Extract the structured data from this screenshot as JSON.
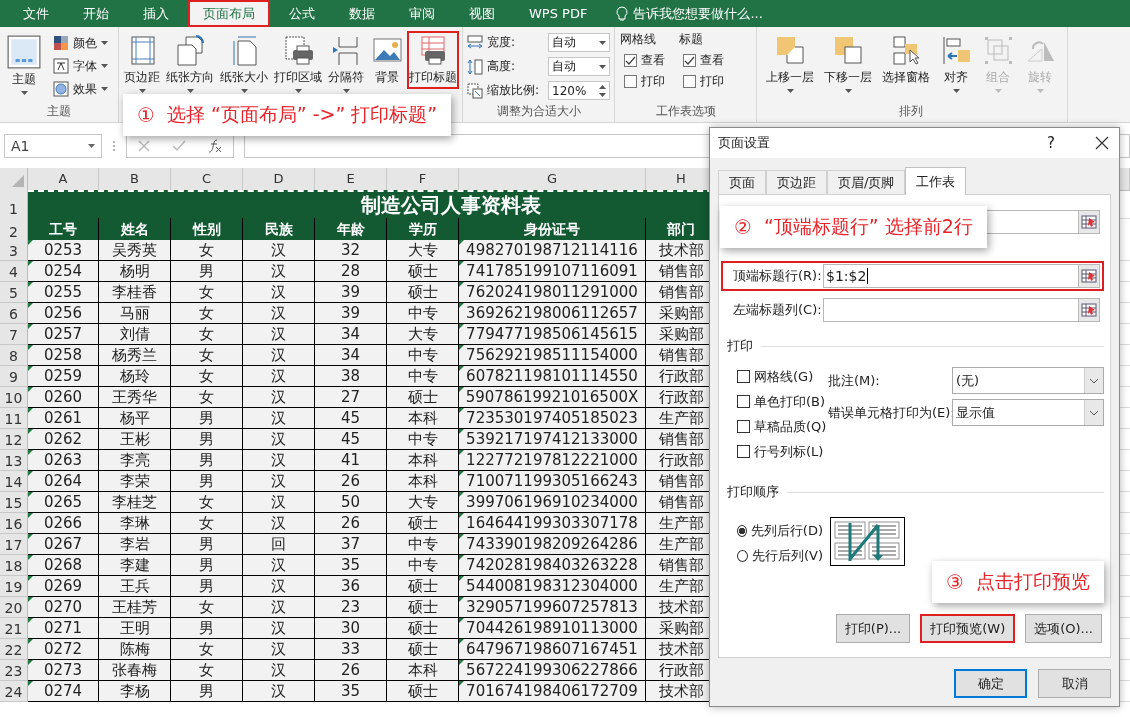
{
  "menu_tabs": [
    {
      "label": "文件",
      "selected": false,
      "highlighted": false
    },
    {
      "label": "开始",
      "selected": false,
      "highlighted": false
    },
    {
      "label": "插入",
      "selected": false,
      "highlighted": false
    },
    {
      "label": "页面布局",
      "selected": true,
      "highlighted": true
    },
    {
      "label": "公式",
      "selected": false,
      "highlighted": false
    },
    {
      "label": "数据",
      "selected": false,
      "highlighted": false
    },
    {
      "label": "审阅",
      "selected": false,
      "highlighted": false
    },
    {
      "label": "视图",
      "selected": false,
      "highlighted": false
    },
    {
      "label": "WPS PDF",
      "selected": false,
      "highlighted": false
    }
  ],
  "tell_me": "告诉我您想要做什么...",
  "ribbon": {
    "theme_group": {
      "label": "主题",
      "button": {
        "label": "主题",
        "has_menu": true
      },
      "options": [
        {
          "label": "颜色",
          "has_menu": true
        },
        {
          "label": "字体",
          "has_menu": true
        },
        {
          "label": "效果",
          "has_menu": true
        }
      ]
    },
    "page_setup_group": {
      "buttons": [
        {
          "label": "页边距",
          "has_menu": true,
          "highlighted": false
        },
        {
          "label": "纸张方向",
          "has_menu": true,
          "highlighted": false
        },
        {
          "label": "纸张大小",
          "has_menu": true,
          "highlighted": false
        },
        {
          "label": "打印区域",
          "has_menu": true,
          "highlighted": false
        },
        {
          "label": "分隔符",
          "has_menu": true,
          "highlighted": false
        },
        {
          "label": "背景",
          "has_menu": false,
          "highlighted": false
        },
        {
          "label": "打印标题",
          "has_menu": false,
          "highlighted": true
        }
      ]
    },
    "scale_group": {
      "label": "调整为合适大小",
      "fields": [
        {
          "label": "宽度:",
          "value": "自动",
          "kind": "dropdown"
        },
        {
          "label": "高度:",
          "value": "自动",
          "kind": "dropdown"
        },
        {
          "label": "缩放比例:",
          "value": "120%",
          "kind": "spinner"
        }
      ]
    },
    "sheet_options_group": {
      "label": "工作表选项",
      "columns": [
        {
          "heading": "网格线",
          "options": [
            {
              "label": "查看",
              "checked": true
            },
            {
              "label": "打印",
              "checked": false
            }
          ]
        },
        {
          "heading": "标题",
          "options": [
            {
              "label": "查看",
              "checked": true
            },
            {
              "label": "打印",
              "checked": false
            }
          ]
        }
      ]
    },
    "arrange_group": {
      "label": "排列",
      "buttons": [
        {
          "label": "上移一层",
          "has_menu": true,
          "disabled": false
        },
        {
          "label": "下移一层",
          "has_menu": true,
          "disabled": false
        },
        {
          "label": "选择窗格",
          "has_menu": false,
          "disabled": false
        },
        {
          "label": "对齐",
          "has_menu": true,
          "disabled": false
        },
        {
          "label": "组合",
          "has_menu": true,
          "disabled": true
        },
        {
          "label": "旋转",
          "has_menu": true,
          "disabled": true
        }
      ]
    }
  },
  "formula_bar": {
    "name_box": "A1"
  },
  "sheet": {
    "columns": [
      "A",
      "B",
      "C",
      "D",
      "E",
      "F",
      "G",
      "H"
    ],
    "title_row": {
      "number": "1",
      "text": "制造公司人事资料表"
    },
    "header_row": {
      "number": "2",
      "cells": [
        "工号",
        "姓名",
        "性别",
        "民族",
        "年龄",
        "学历",
        "身份证号",
        "部门"
      ]
    },
    "rows": [
      {
        "number": "3",
        "cells": [
          "0253",
          "吴秀英",
          "女",
          "汉",
          "32",
          "大专",
          "498270198712114116",
          "技术部"
        ]
      },
      {
        "number": "4",
        "cells": [
          "0254",
          "杨明",
          "男",
          "汉",
          "28",
          "硕士",
          "741785199107116091",
          "销售部"
        ]
      },
      {
        "number": "5",
        "cells": [
          "0255",
          "李桂香",
          "女",
          "汉",
          "39",
          "硕士",
          "762024198011291000",
          "销售部"
        ]
      },
      {
        "number": "6",
        "cells": [
          "0256",
          "马丽",
          "女",
          "汉",
          "39",
          "中专",
          "369262198006112657",
          "采购部"
        ]
      },
      {
        "number": "7",
        "cells": [
          "0257",
          "刘倩",
          "女",
          "汉",
          "34",
          "大专",
          "779477198506145615",
          "采购部"
        ]
      },
      {
        "number": "8",
        "cells": [
          "0258",
          "杨秀兰",
          "女",
          "汉",
          "34",
          "中专",
          "756292198511154000",
          "销售部"
        ]
      },
      {
        "number": "9",
        "cells": [
          "0259",
          "杨玲",
          "女",
          "汉",
          "38",
          "中专",
          "607821198101114550",
          "行政部"
        ]
      },
      {
        "number": "10",
        "cells": [
          "0260",
          "王秀华",
          "女",
          "汉",
          "27",
          "硕士",
          "59078619921016500X",
          "行政部"
        ]
      },
      {
        "number": "11",
        "cells": [
          "0261",
          "杨平",
          "男",
          "汉",
          "45",
          "本科",
          "723530197405185023",
          "生产部"
        ]
      },
      {
        "number": "12",
        "cells": [
          "0262",
          "王彬",
          "男",
          "汉",
          "45",
          "中专",
          "539217197412133000",
          "销售部"
        ]
      },
      {
        "number": "13",
        "cells": [
          "0263",
          "李亮",
          "男",
          "汉",
          "41",
          "本科",
          "122772197812221000",
          "行政部"
        ]
      },
      {
        "number": "14",
        "cells": [
          "0264",
          "李荣",
          "男",
          "汉",
          "26",
          "本科",
          "710071199305166243",
          "销售部"
        ]
      },
      {
        "number": "15",
        "cells": [
          "0265",
          "李桂芝",
          "女",
          "汉",
          "50",
          "大专",
          "399706196910234000",
          "销售部"
        ]
      },
      {
        "number": "16",
        "cells": [
          "0266",
          "李琳",
          "女",
          "汉",
          "26",
          "硕士",
          "164644199303307178",
          "生产部"
        ]
      },
      {
        "number": "17",
        "cells": [
          "0267",
          "李岩",
          "男",
          "回",
          "37",
          "中专",
          "743390198209264286",
          "生产部"
        ]
      },
      {
        "number": "18",
        "cells": [
          "0268",
          "李建",
          "男",
          "汉",
          "35",
          "中专",
          "742028198403263228",
          "销售部"
        ]
      },
      {
        "number": "19",
        "cells": [
          "0269",
          "王兵",
          "男",
          "汉",
          "36",
          "硕士",
          "544008198312304000",
          "生产部"
        ]
      },
      {
        "number": "20",
        "cells": [
          "0270",
          "王桂芳",
          "女",
          "汉",
          "23",
          "硕士",
          "329057199607257813",
          "技术部"
        ]
      },
      {
        "number": "21",
        "cells": [
          "0271",
          "王明",
          "男",
          "汉",
          "30",
          "硕士",
          "704426198910113000",
          "采购部"
        ]
      },
      {
        "number": "22",
        "cells": [
          "0272",
          "陈梅",
          "女",
          "汉",
          "33",
          "硕士",
          "647967198607167451",
          "技术部"
        ]
      },
      {
        "number": "23",
        "cells": [
          "0273",
          "张春梅",
          "女",
          "汉",
          "26",
          "本科",
          "567224199306227866",
          "行政部"
        ]
      },
      {
        "number": "24",
        "cells": [
          "0274",
          "李杨",
          "男",
          "汉",
          "35",
          "硕士",
          "701674198406172709",
          "技术部"
        ]
      }
    ]
  },
  "dialog": {
    "title": "页面设置",
    "help": "?",
    "tabs": [
      {
        "label": "页面",
        "selected": false
      },
      {
        "label": "页边距",
        "selected": false
      },
      {
        "label": "页眉/页脚",
        "selected": false
      },
      {
        "label": "工作表",
        "selected": true
      }
    ],
    "title_rows": {
      "label": "顶端标题行(R):",
      "value": "$1:$2",
      "highlighted": true
    },
    "title_columns": {
      "label": "左端标题列(C):"
    },
    "print_section": {
      "heading": "打印",
      "options": [
        {
          "label": "网格线(G)",
          "checked": false
        },
        {
          "label": "单色打印(B)",
          "checked": false
        },
        {
          "label": "草稿品质(Q)",
          "checked": false
        },
        {
          "label": "行号列标(L)",
          "checked": false
        }
      ],
      "comments": {
        "label": "批注(M):",
        "value": "(无)"
      },
      "errors": {
        "label": "错误单元格打印为(E):",
        "value": "显示值"
      }
    },
    "order_section": {
      "heading": "打印顺序",
      "options": [
        {
          "label": "先列后行(D)",
          "selected": true
        },
        {
          "label": "先行后列(V)",
          "selected": false
        }
      ]
    },
    "buttons": [
      {
        "label": "打印(P)...",
        "highlighted": false
      },
      {
        "label": "打印预览(W)",
        "highlighted": true
      },
      {
        "label": "选项(O)...",
        "highlighted": false
      }
    ],
    "footer_buttons": [
      {
        "label": "确定",
        "default": true
      },
      {
        "label": "取消",
        "default": false
      }
    ]
  },
  "callouts": [
    {
      "number": "①",
      "text": "选择 “页面布局” ->” 打印标题”"
    },
    {
      "number": "②",
      "text": "“顶端标题行” 选择前2行"
    },
    {
      "number": "③",
      "text": "点击打印预览"
    }
  ]
}
